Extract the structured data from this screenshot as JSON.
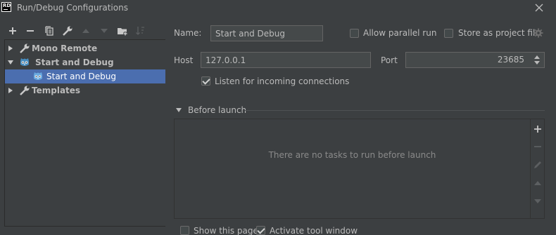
{
  "window": {
    "title": "Run/Debug Configurations",
    "logo_text": "RD"
  },
  "toolbar": {
    "icons": [
      "add-icon",
      "remove-icon",
      "copy-icon",
      "wrench-icon",
      "move-up-icon",
      "move-down-icon",
      "new-folder-icon",
      "sort-icon"
    ]
  },
  "tree": {
    "items": [
      {
        "label": "Mono Remote",
        "expanded": false,
        "icon": "wrench-icon"
      },
      {
        "label": "Start and Debug",
        "expanded": true,
        "icon": "godot-icon"
      },
      {
        "label": "Start and Debug",
        "selected": true,
        "icon": "godot-icon"
      },
      {
        "label": "Templates",
        "expanded": false,
        "icon": "wrench-icon"
      }
    ]
  },
  "form": {
    "name_label": "Name:",
    "name_value": "Start and Debug",
    "allow_parallel_label": "Allow parallel run",
    "allow_parallel_checked": false,
    "store_project_label": "Store as project file",
    "store_project_checked": false,
    "host_label": "Host",
    "host_value": "127.0.0.1",
    "port_label": "Port",
    "port_value": "23685",
    "listen_label": "Listen for incoming connections",
    "listen_checked": true
  },
  "before_launch": {
    "title": "Before launch",
    "empty_text": "There are no tasks to run before launch"
  },
  "footer": {
    "show_page_label": "Show this page",
    "show_page_checked": false,
    "activate_tool_label": "Activate tool window",
    "activate_tool_checked": true
  },
  "colors": {
    "background": "#3c3f41",
    "selection": "#4b6eaf",
    "text": "#bbbbbb",
    "godot_blue": "#478cbf"
  }
}
